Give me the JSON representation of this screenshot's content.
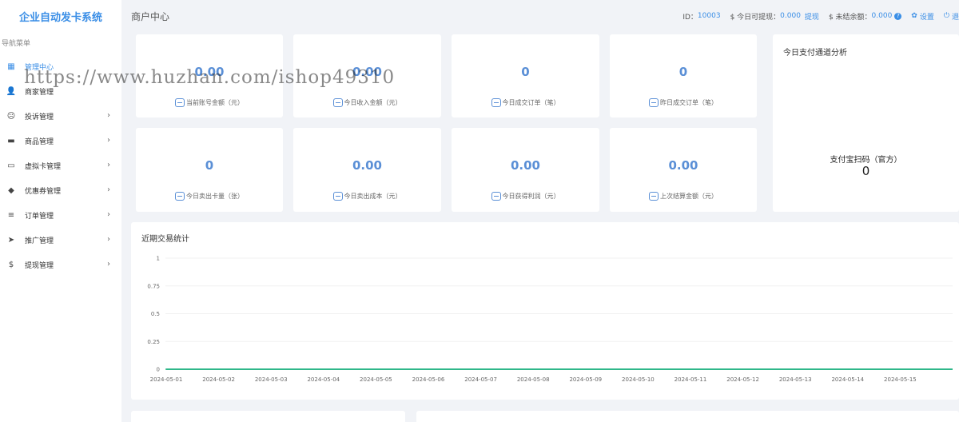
{
  "brand": "企业自动发卡系统",
  "nav": {
    "caption": "导航菜单",
    "items": [
      {
        "label": "管理中心",
        "icon": "dashboard-icon",
        "glyph": "▦",
        "active": true,
        "chevron": false
      },
      {
        "label": "商家管理",
        "icon": "user-icon",
        "glyph": "👤",
        "active": false,
        "chevron": false
      },
      {
        "label": "投诉管理",
        "icon": "complaint-icon",
        "glyph": "☹",
        "active": false,
        "chevron": true
      },
      {
        "label": "商品管理",
        "icon": "goods-icon",
        "glyph": "▬",
        "active": false,
        "chevron": true
      },
      {
        "label": "虚拟卡管理",
        "icon": "card-icon",
        "glyph": "▭",
        "active": false,
        "chevron": true
      },
      {
        "label": "优惠券管理",
        "icon": "tag-icon",
        "glyph": "◆",
        "active": false,
        "chevron": true
      },
      {
        "label": "订单管理",
        "icon": "list-icon",
        "glyph": "≡",
        "active": false,
        "chevron": true
      },
      {
        "label": "推广管理",
        "icon": "send-icon",
        "glyph": "➤",
        "active": false,
        "chevron": true
      },
      {
        "label": "提现管理",
        "icon": "dollar-icon",
        "glyph": "$",
        "active": false,
        "chevron": true
      }
    ],
    "chevron_glyph": "›"
  },
  "header": {
    "title": "商户中心",
    "id_label": "ID：",
    "id_value": "10003",
    "withdrawable_label": "$ 今日可提现：",
    "withdrawable_value": "0.000",
    "withdraw_link": "提现",
    "unsettled_label": "$ 未结余额：",
    "unsettled_value": "0.000",
    "help_glyph": "?",
    "settings_label": "设置",
    "settings_glyph": "✿",
    "logout_label": "退",
    "logout_glyph": "⏻"
  },
  "stats": [
    {
      "value": "0.00",
      "label": "当前账号金额（元）",
      "icon": "wallet-icon"
    },
    {
      "value": "0.00",
      "label": "今日收入金额（元）",
      "icon": "coin-icon"
    },
    {
      "value": "0",
      "label": "今日成交订单（笔）",
      "icon": "order-icon"
    },
    {
      "value": "0",
      "label": "昨日成交订单（笔）",
      "icon": "calendar-icon"
    },
    {
      "value": "0",
      "label": "今日卖出卡量（张）",
      "icon": "card-stack-icon"
    },
    {
      "value": "0.00",
      "label": "今日卖出成本（元）",
      "icon": "database-icon"
    },
    {
      "value": "0.00",
      "label": "今日获得利润（元）",
      "icon": "profit-icon"
    },
    {
      "value": "0.00",
      "label": "上次结算金额（元）",
      "icon": "settlement-icon"
    }
  ],
  "payment": {
    "title": "今日支付通道分析",
    "channel": "支付宝扫码（官方）",
    "value": "0"
  },
  "watermark": "https://www.huzhan.com/ishop49310",
  "chart_title": "近期交易统计",
  "chart_data": {
    "type": "line",
    "title": "近期交易统计",
    "x": [
      "2024-05-01",
      "2024-05-02",
      "2024-05-03",
      "2024-05-04",
      "2024-05-05",
      "2024-05-06",
      "2024-05-07",
      "2024-05-08",
      "2024-05-09",
      "2024-05-10",
      "2024-05-11",
      "2024-05-12",
      "2024-05-13",
      "2024-05-14",
      "2024-05-15"
    ],
    "series": [
      {
        "values": [
          0,
          0,
          0,
          0,
          0,
          0,
          0,
          0,
          0,
          0,
          0,
          0,
          0,
          0,
          0
        ]
      }
    ],
    "yticks": [
      "0",
      "0.25",
      "0.5",
      "0.75",
      "1"
    ],
    "ylim": [
      0,
      1
    ],
    "grid": true,
    "line_color": "#2fb78a"
  }
}
